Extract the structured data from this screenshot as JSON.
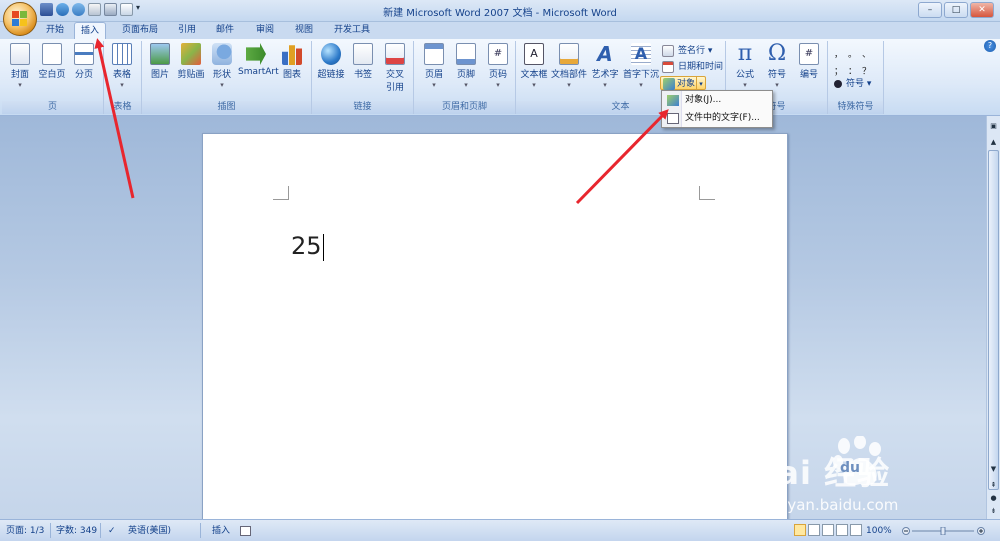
{
  "window": {
    "title": "新建 Microsoft Word 2007 文档 - Microsoft Word"
  },
  "tabs": [
    {
      "label": "开始",
      "active": false
    },
    {
      "label": "插入",
      "active": true
    },
    {
      "label": "页面布局",
      "active": false
    },
    {
      "label": "引用",
      "active": false
    },
    {
      "label": "邮件",
      "active": false
    },
    {
      "label": "审阅",
      "active": false
    },
    {
      "label": "视图",
      "active": false
    },
    {
      "label": "开发工具",
      "active": false
    }
  ],
  "ribbon": {
    "groups": {
      "pages": {
        "label": "页",
        "buttons": [
          "封面",
          "空白页",
          "分页"
        ]
      },
      "table": {
        "label": "表格",
        "buttons": [
          "表格"
        ]
      },
      "illustrations": {
        "label": "插图",
        "buttons": [
          "图片",
          "剪贴画",
          "形状",
          "SmartArt",
          "图表"
        ]
      },
      "links": {
        "label": "链接",
        "buttons": [
          "超链接",
          "书签",
          "交叉",
          "引用"
        ]
      },
      "header_footer": {
        "label": "页眉和页脚",
        "buttons": [
          "页眉",
          "页脚",
          "页码"
        ]
      },
      "text": {
        "label": "文本",
        "buttons": [
          "文本框",
          "文档部件",
          "艺术字",
          "首字下沉"
        ],
        "small": [
          "签名行",
          "日期和时间",
          "对象"
        ]
      },
      "symbols": {
        "label": "符号",
        "buttons": [
          "公式",
          "符号",
          "编号"
        ]
      },
      "special": {
        "label": "特殊符号",
        "small": [
          "符号"
        ],
        "chars": [
          "，",
          "。",
          "、",
          "；",
          "：",
          "？"
        ]
      }
    }
  },
  "dropdown": {
    "items": [
      "对象(J)...",
      "文件中的文字(F)..."
    ]
  },
  "document": {
    "text": "25"
  },
  "status": {
    "page": "页面: 1/3",
    "words": "字数: 349",
    "language": "英语(美国)",
    "mode": "插入",
    "zoom": "100%"
  },
  "watermark": {
    "main": "Bai  经验",
    "du": "du",
    "sub": "jingyan.baidu.com"
  },
  "colors": {
    "accent": "#15428b",
    "arrow": "#e8262e",
    "ribbon_bg": "#dde9f8"
  }
}
